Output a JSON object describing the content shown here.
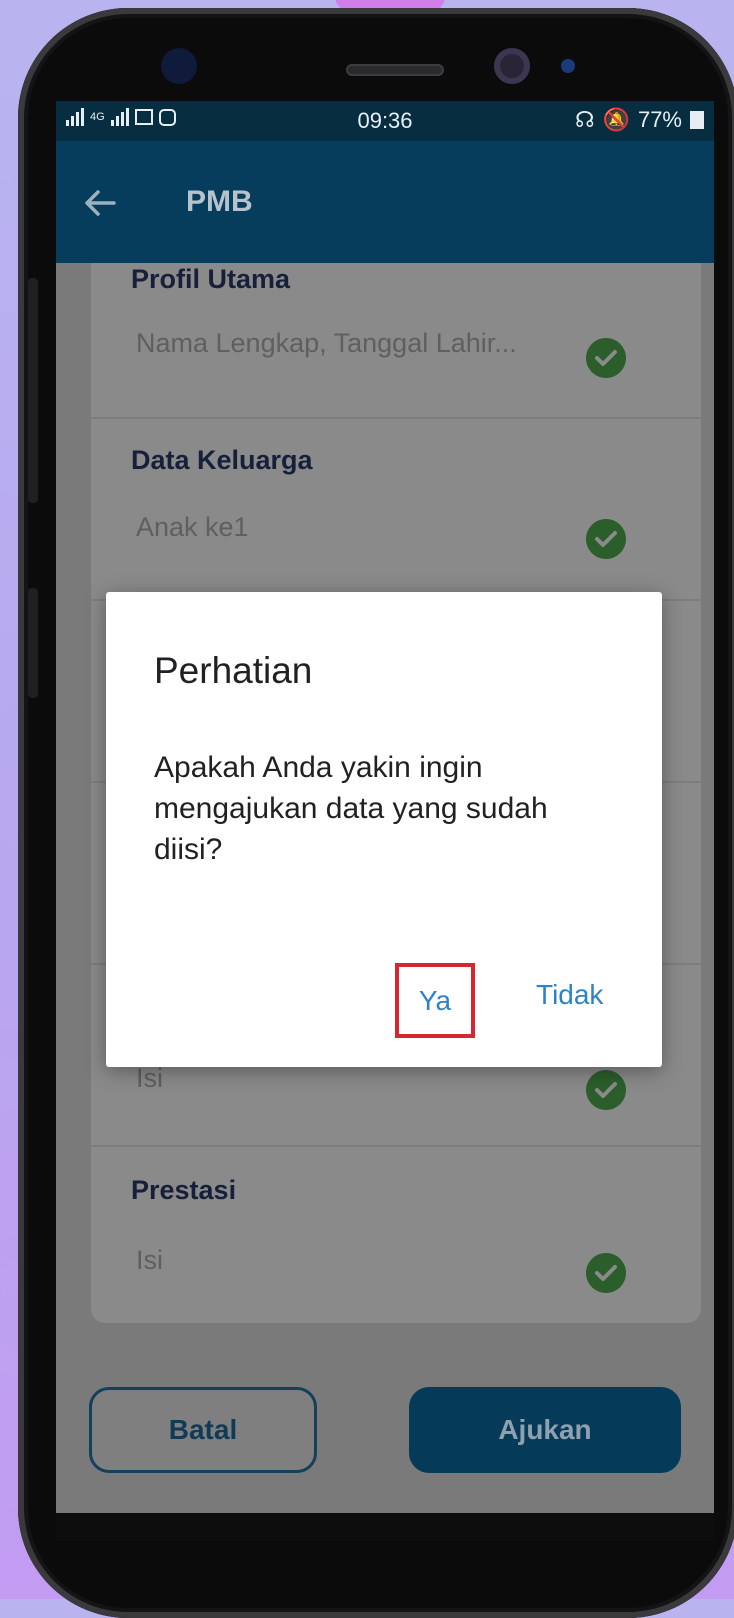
{
  "status_bar": {
    "network": "4G",
    "time": "09:36",
    "battery": "77%"
  },
  "app_bar": {
    "title": "PMB"
  },
  "sections": [
    {
      "label": "Profil Utama",
      "value": "Nama Lengkap, Tanggal Lahir..."
    },
    {
      "label": "Data Keluarga",
      "value": "Anak ke1"
    },
    {
      "label": "",
      "value": "Isi"
    },
    {
      "label": "Prestasi",
      "value": "Isi"
    }
  ],
  "actions": {
    "cancel_label": "Batal",
    "submit_label": "Ajukan"
  },
  "dialog": {
    "title": "Perhatian",
    "message": "Apakah Anda yakin ingin mengajukan data yang sudah diisi?",
    "confirm_label": "Ya",
    "deny_label": "Tidak",
    "highlight_color": "#d7262f"
  },
  "colors": {
    "primary": "#063c5c",
    "check": "#2e7d32",
    "accent_text": "#2d84c5"
  }
}
